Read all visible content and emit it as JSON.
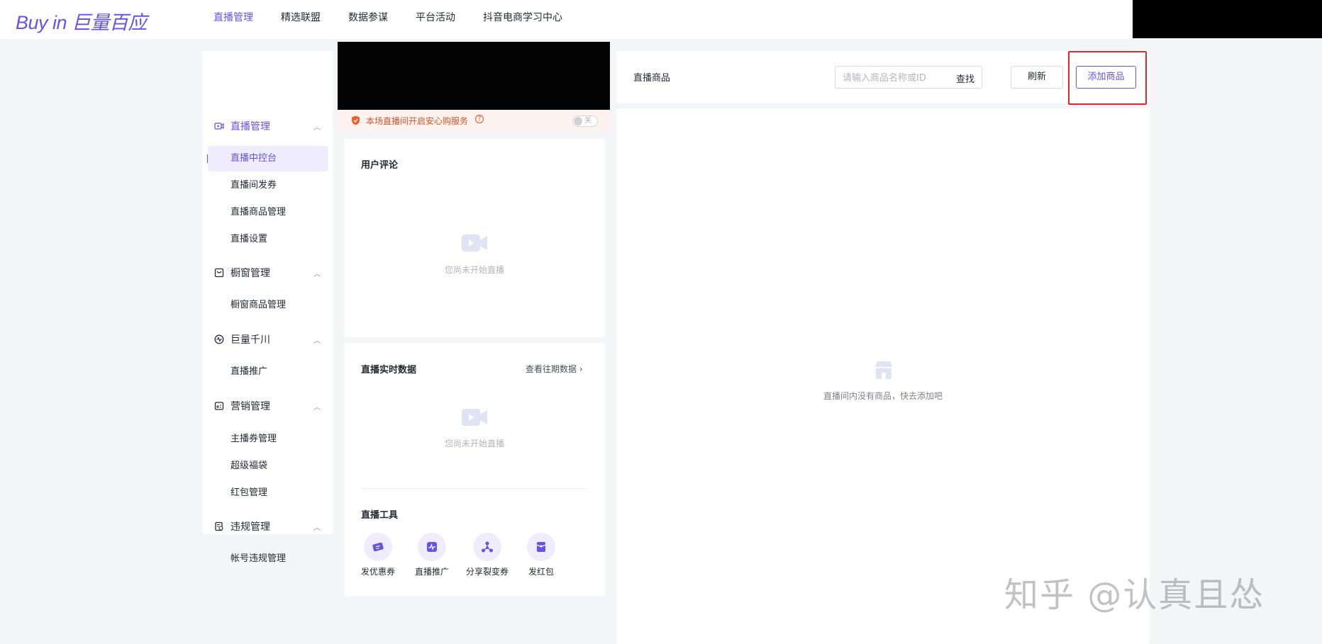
{
  "header": {
    "logo_text": "Buy in 巨量百应",
    "nav": [
      {
        "label": "直播管理",
        "active": true
      },
      {
        "label": "精选联盟",
        "active": false
      },
      {
        "label": "数据参谋",
        "active": false
      },
      {
        "label": "平台活动",
        "active": false
      },
      {
        "label": "抖音电商学习中心",
        "active": false
      }
    ]
  },
  "sidebar": {
    "groups": [
      {
        "label": "直播管理",
        "icon": "live-camera-icon",
        "active": true,
        "items": [
          "直播中控台",
          "直播间发券",
          "直播商品管理",
          "直播设置"
        ],
        "active_item": "直播中控台"
      },
      {
        "label": "橱窗管理",
        "icon": "shop-window-icon",
        "active": false,
        "items": [
          "橱窗商品管理"
        ]
      },
      {
        "label": "巨量千川",
        "icon": "pulse-circle-icon",
        "active": false,
        "items": [
          "直播推广"
        ]
      },
      {
        "label": "营销管理",
        "icon": "coupon-box-icon",
        "active": false,
        "items": [
          "主播券管理",
          "超级福袋",
          "红包管理"
        ]
      },
      {
        "label": "违规管理",
        "icon": "violation-doc-icon",
        "active": false,
        "items": [
          "帐号违规管理"
        ]
      }
    ]
  },
  "live": {
    "notice_text": "本场直播间开启安心购服务",
    "toggle_label": "关",
    "toggle_on": false
  },
  "comments": {
    "title": "用户评论",
    "empty_text": "您尚未开始直播"
  },
  "realtime": {
    "title": "直播实时数据",
    "history_link": "查看往期数据",
    "empty_text": "您尚未开始直播"
  },
  "tools": {
    "title": "直播工具",
    "items": [
      {
        "label": "发优惠券",
        "icon": "coupon-icon"
      },
      {
        "label": "直播推广",
        "icon": "promote-chart-icon"
      },
      {
        "label": "分享裂变券",
        "icon": "share-split-icon"
      },
      {
        "label": "发红包",
        "icon": "red-envelope-icon"
      }
    ]
  },
  "products": {
    "title": "直播商品",
    "search_placeholder": "请输入商品名称或ID",
    "search_button": "查找",
    "refresh_button": "刷新",
    "add_button": "添加商品",
    "empty_text": "直播间内没有商品，快去添加吧"
  },
  "watermark": "知乎 @认真且怂",
  "colors": {
    "accent": "#6552e8",
    "highlight": "#e0272a",
    "notice": "#d2562e"
  }
}
